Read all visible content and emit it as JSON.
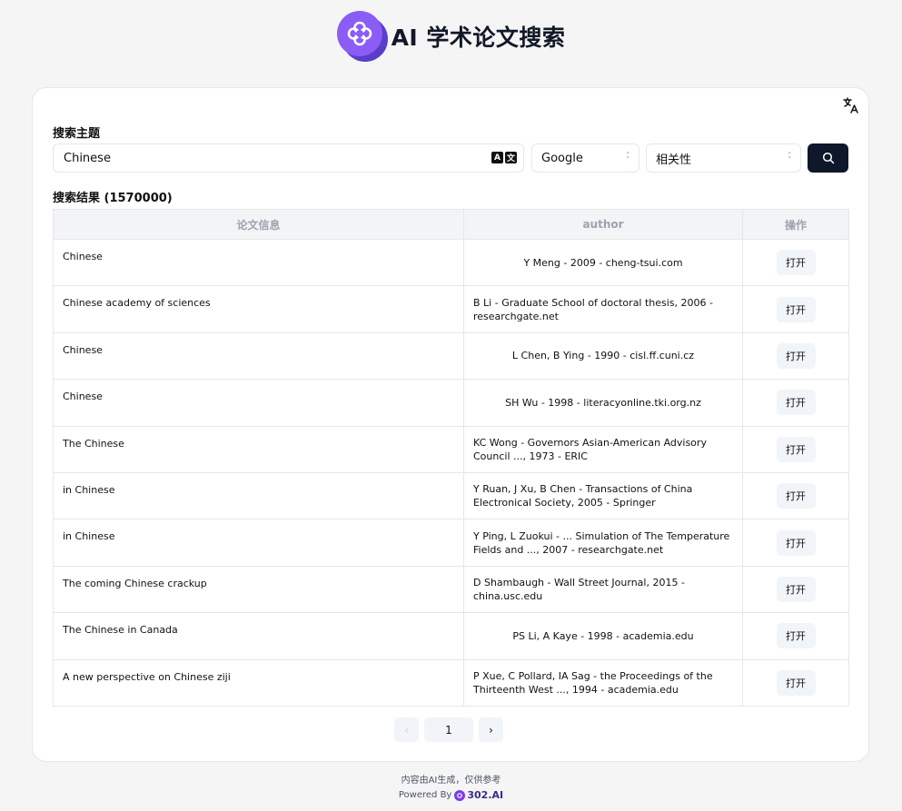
{
  "header": {
    "title": "AI 学术论文搜索",
    "logo_color": "#8b5cf6"
  },
  "search": {
    "topic_label": "搜索主题",
    "query": "Chinese",
    "engine": "Google",
    "sort": "相关性",
    "translate_icons": [
      "A",
      "文"
    ]
  },
  "results": {
    "label": "搜索结果 (1570000)",
    "columns": [
      "论文信息",
      "author",
      "操作"
    ],
    "open_label": "打开",
    "rows": [
      {
        "title": "Chinese",
        "author": "Y Meng - 2009 - cheng-tsui.com"
      },
      {
        "title": "Chinese academy of sciences",
        "author": "B Li - Graduate School of doctoral thesis, 2006 - researchgate.net"
      },
      {
        "title": "Chinese",
        "author": "L Chen, B Ying - 1990 - cisl.ff.cuni.cz"
      },
      {
        "title": "Chinese",
        "author": "SH Wu - 1998 - literacyonline.tki.org.nz"
      },
      {
        "title": "The Chinese",
        "author": "KC Wong - Governors Asian-American Advisory Council ..., 1973 - ERIC"
      },
      {
        "title": "in Chinese",
        "author": "Y Ruan, J Xu, B Chen - Transactions of China Electronical Society, 2005 - Springer"
      },
      {
        "title": "in Chinese",
        "author": "Y Ping, L Zuokui - ... Simulation of The Temperature Fields and ..., 2007 - researchgate.net"
      },
      {
        "title": "The coming Chinese crackup",
        "author": "D Shambaugh - Wall Street Journal, 2015 - china.usc.edu"
      },
      {
        "title": "The Chinese in Canada",
        "author": "PS Li, A Kaye - 1998 - academia.edu"
      },
      {
        "title": "A new perspective on Chinese ziji",
        "author": "P Xue, C Pollard, IA Sag - the Proceedings of the Thirteenth West ..., 1994 - academia.edu"
      }
    ]
  },
  "pagination": {
    "prev": "‹",
    "current": "1",
    "next": "›"
  },
  "footer": {
    "disclaimer": "内容由AI生成，仅供参考",
    "powered_by": "Powered By",
    "brand": "302.AI"
  }
}
